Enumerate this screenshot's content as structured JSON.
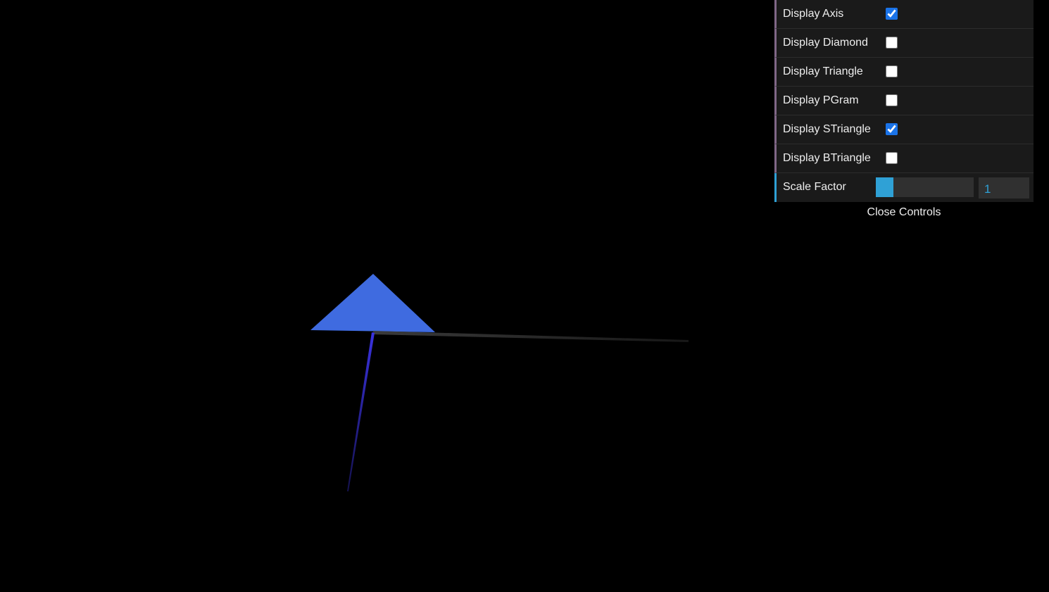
{
  "scene": {
    "axis_color": "#3a3a3a",
    "z_axis_color": "#3a32e0",
    "triangle_color": "#3f6be0"
  },
  "controls": {
    "checkboxes": [
      {
        "label": "Display Axis",
        "checked": true
      },
      {
        "label": "Display Diamond",
        "checked": false
      },
      {
        "label": "Display Triangle",
        "checked": false
      },
      {
        "label": "Display PGram",
        "checked": false
      },
      {
        "label": "Display STriangle",
        "checked": true
      },
      {
        "label": "Display BTriangle",
        "checked": false
      }
    ],
    "scale": {
      "label": "Scale Factor",
      "value": "1",
      "slider_fraction": 0.18
    },
    "close_label": "Close Controls"
  }
}
